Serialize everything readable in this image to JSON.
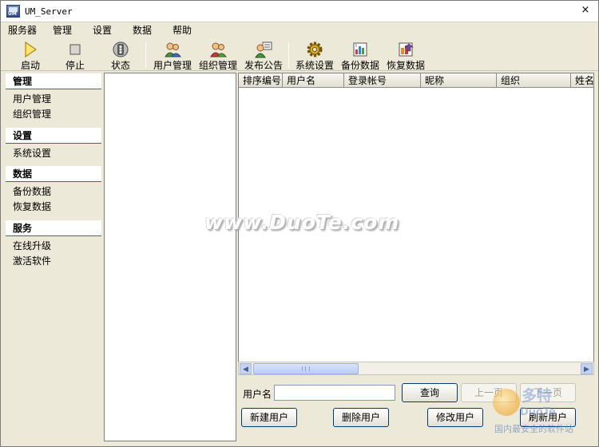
{
  "window": {
    "title": "UM_Server",
    "close_glyph": "×"
  },
  "menu": [
    {
      "label": "服务器"
    },
    {
      "label": "管理"
    },
    {
      "label": "设置"
    },
    {
      "label": "数据"
    },
    {
      "label": "帮助"
    }
  ],
  "toolbar": [
    {
      "label": "启动",
      "icon": "play-icon"
    },
    {
      "label": "停止",
      "icon": "stop-icon"
    },
    {
      "label": "状态",
      "icon": "status-icon"
    },
    {
      "label": "用户管理",
      "icon": "user-manage-icon"
    },
    {
      "label": "组织管理",
      "icon": "org-manage-icon"
    },
    {
      "label": "发布公告",
      "icon": "announce-icon"
    },
    {
      "label": "系统设置",
      "icon": "gear-icon"
    },
    {
      "label": "备份数据",
      "icon": "backup-icon"
    },
    {
      "label": "恢复数据",
      "icon": "restore-icon"
    }
  ],
  "nav": [
    {
      "title": "管理",
      "items": [
        "用户管理",
        "组织管理"
      ]
    },
    {
      "title": "设置",
      "items": [
        "系统设置"
      ]
    },
    {
      "title": "数据",
      "items": [
        "备份数据",
        "恢复数据"
      ]
    },
    {
      "title": "服务",
      "items": [
        "在线升级",
        "激活软件"
      ]
    }
  ],
  "grid": {
    "columns": [
      "排序编号",
      "用户名",
      "登录帐号",
      "昵称",
      "组织",
      "姓名"
    ]
  },
  "scrollbar": {
    "left_glyph": "◀",
    "right_glyph": "▶"
  },
  "form": {
    "username_label": "用户名",
    "username_value": "",
    "query": "查询",
    "prev": "上一页",
    "next": "下一页",
    "new_user": "新建用户",
    "delete_user": "删除用户",
    "edit_user": "修改用户",
    "refresh_user": "刷新用户"
  },
  "watermark": {
    "site": "www.DuoTe.com",
    "logo_cn": "多特",
    "logo_en": "DuoTe",
    "logo_tag": "国内最安全的软件站"
  },
  "colors": {
    "nav_rule": "#3b64a8",
    "window_bg": "#ece9d8"
  }
}
